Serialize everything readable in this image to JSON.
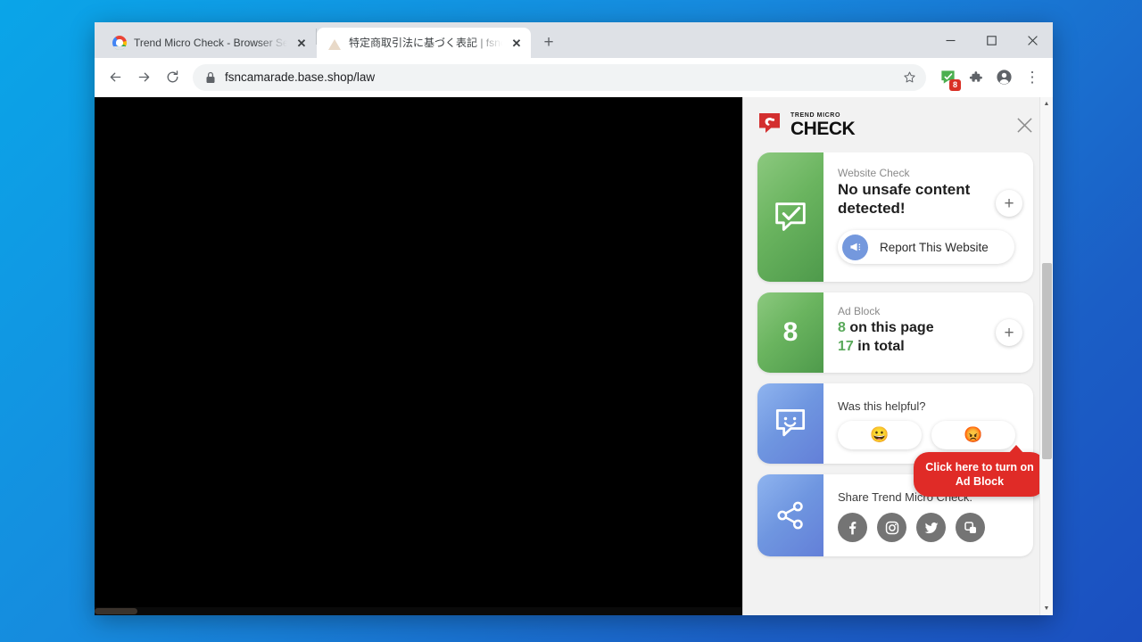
{
  "browser": {
    "tabs": [
      {
        "title": "Trend Micro Check - Browser Sec",
        "favicon": "chrome-icon",
        "active": false,
        "close_label": "✕"
      },
      {
        "title": "特定商取引法に基づく表記 | fsnca",
        "favicon": "site-icon",
        "active": true,
        "close_label": "✕"
      }
    ],
    "new_tab_label": "+",
    "window_controls": {
      "minimize": "—",
      "maximize": "☐",
      "close": "✕"
    },
    "toolbar": {
      "back_label": "←",
      "forward_label": "→",
      "reload_label": "⟳",
      "url": "fsncamarade.base.shop/law",
      "lock_icon": "lock-icon",
      "star_label": "☆",
      "extension_badge": "8",
      "puzzle_icon": "extensions-puzzle-icon",
      "profile_icon": "profile-avatar-icon",
      "menu_label": "⋮"
    }
  },
  "panel": {
    "logo": {
      "top_text": "TREND MICRO",
      "main_text": "CHECK"
    },
    "close_label": "✕",
    "cards": {
      "website_check": {
        "label": "Website Check",
        "title": "No unsafe content detected!",
        "plus_label": "+",
        "report_button": "Report This Website",
        "tile_icon": "speech-bubble-check-icon"
      },
      "ad_block": {
        "tile_number": "8",
        "label": "Ad Block",
        "count_page": "8",
        "text_page": "on this page",
        "count_total": "17",
        "text_total": "in total",
        "plus_label": "+"
      },
      "feedback": {
        "question": "Was this helpful?",
        "positive_emoji": "😀",
        "negative_emoji": "😡",
        "tile_icon": "speech-bubble-smiley-icon"
      },
      "share": {
        "label": "Share Trend Micro Check:",
        "tile_icon": "share-nodes-icon",
        "icons": [
          "facebook-icon",
          "instagram-icon",
          "twitter-icon",
          "copy-link-icon"
        ]
      }
    },
    "tooltip": "Click here to turn on Ad Block",
    "colors": {
      "tooltip_red": "#e02b27",
      "green_accent": "#59a95a",
      "tile_green": "#6ab45f",
      "tile_blue": "#6f96e0",
      "badge_red": "#d93025"
    }
  }
}
